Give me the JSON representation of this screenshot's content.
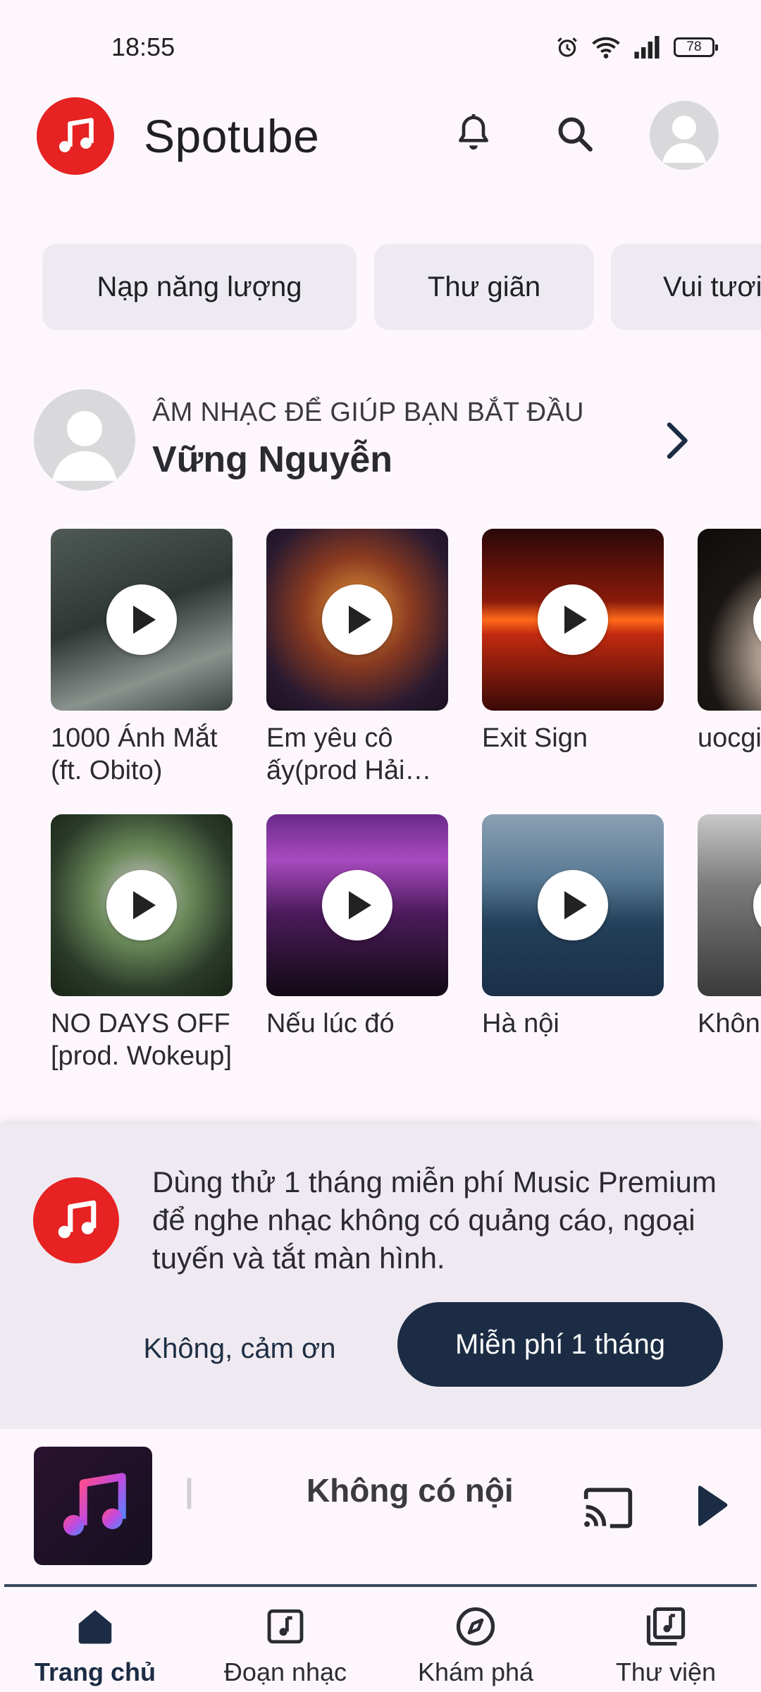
{
  "status_bar": {
    "time": "18:55",
    "battery": "78"
  },
  "header": {
    "app_title": "Spotube"
  },
  "chips": [
    "Nạp năng lượng",
    "Thư giãn",
    "Vui tươi"
  ],
  "section": {
    "subtitle": "ÂM NHẠC ĐỂ GIÚP BẠN BẮT ĐẦU",
    "title": "Vững Nguyễn"
  },
  "songs": [
    {
      "title": "1000 Ánh Mắt (ft. Obito)"
    },
    {
      "title": "Em yêu cô ấy(prod Hải Đăng)"
    },
    {
      "title": "Exit Sign"
    },
    {
      "title": "uocgi yeutoi"
    },
    {
      "title": "NO DAYS OFF [prod. Wokeup]"
    },
    {
      "title": "Nếu lúc đó"
    },
    {
      "title": "Hà nội"
    },
    {
      "title": "Không Xin Đâu"
    }
  ],
  "premium": {
    "message": "Dùng thử 1 tháng miễn phí Music Premium để nghe nhạc không có quảng cáo, ngoại tuyến và tắt màn hình.",
    "decline_label": "Không, cảm ơn",
    "accept_label": "Miễn phí 1 tháng"
  },
  "player": {
    "title": "Không có nội dung"
  },
  "nav": [
    {
      "label": "Trang chủ",
      "icon": "home-icon"
    },
    {
      "label": "Đoạn nhạc",
      "icon": "music-note-box-icon"
    },
    {
      "label": "Khám phá",
      "icon": "compass-icon"
    },
    {
      "label": "Thư viện",
      "icon": "library-icon"
    }
  ],
  "colors": {
    "brand": "#e62222",
    "primary": "#1c2c44",
    "background": "#fdf7fd"
  }
}
